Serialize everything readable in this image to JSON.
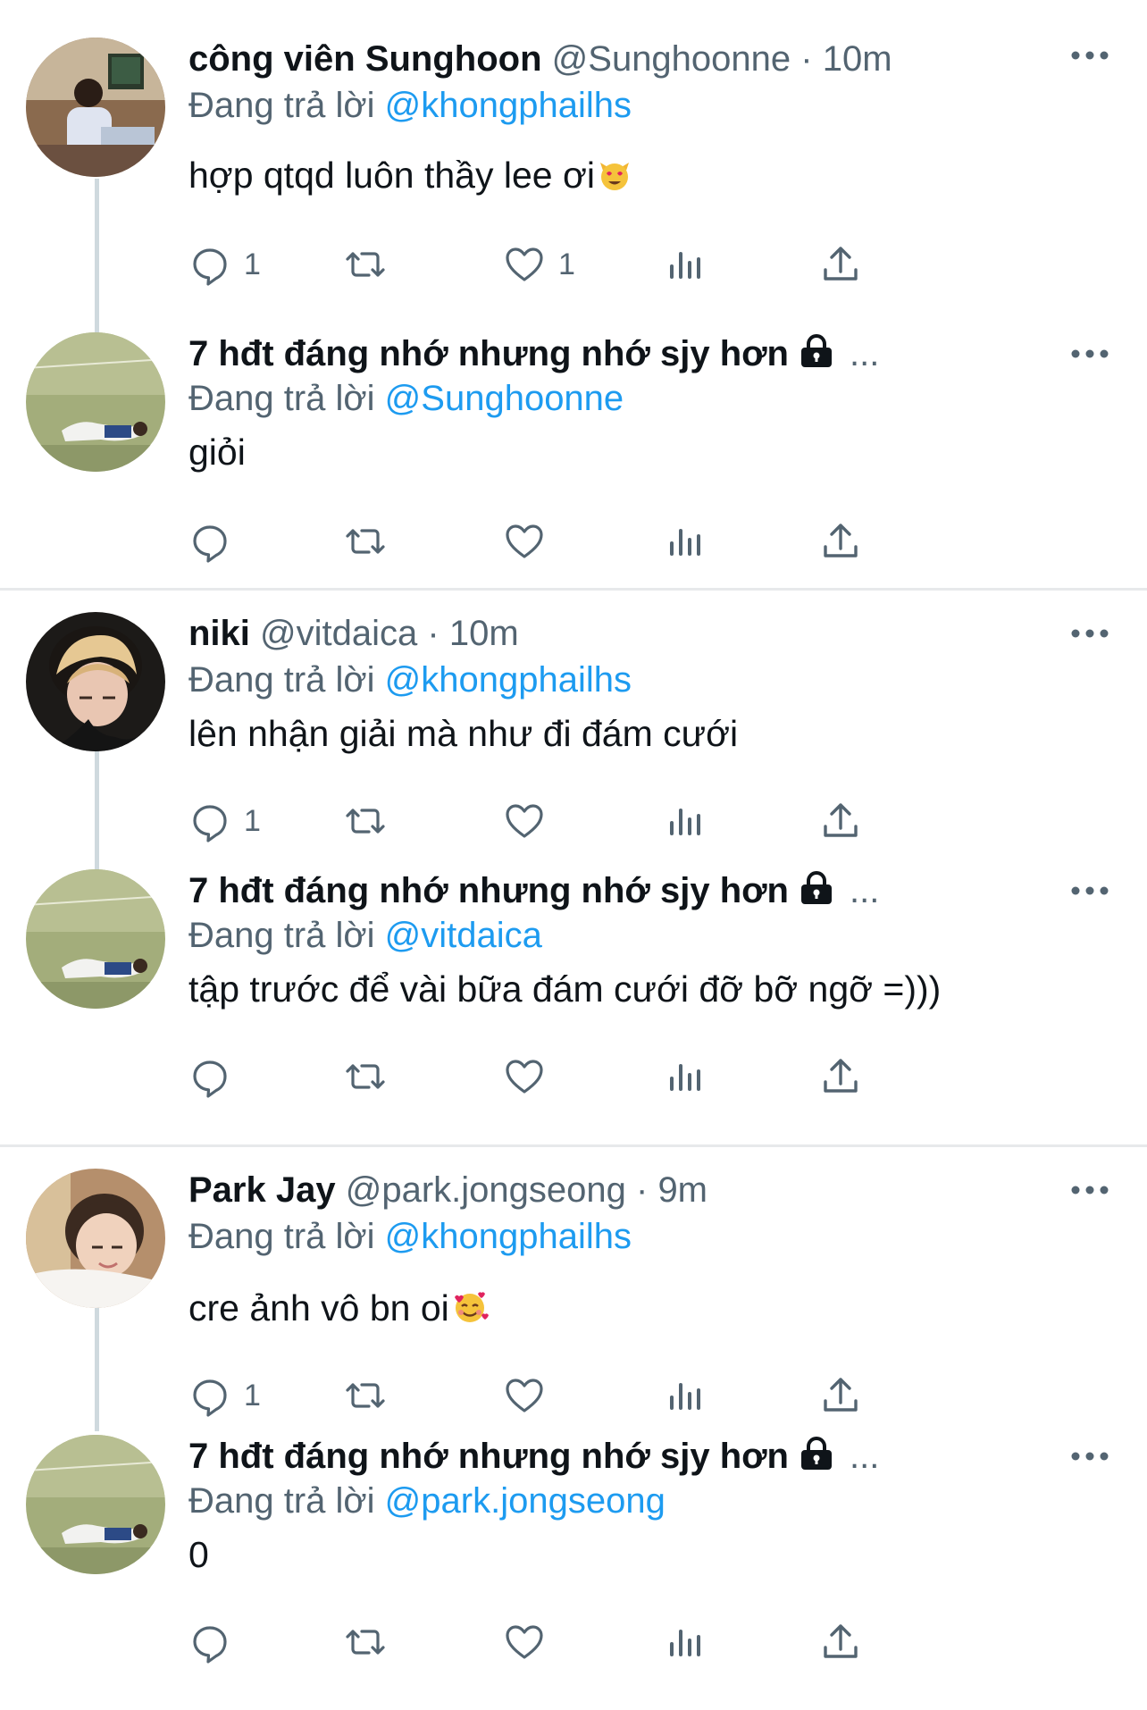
{
  "threads": [
    {
      "parent": {
        "name": "công viên Sunghoon",
        "handle": "@Sunghoonne",
        "dot": "·",
        "time": "10m",
        "replying_prefix": "Đang trả lời",
        "replying_to": "@khongphailhs",
        "text": "hợp qtqd luôn thầy lee ơi",
        "reply_count": "1",
        "retweet_count": "",
        "like_count": "1"
      },
      "reply": {
        "name": "7 hđt đáng nhớ nhưng nhớ sjy hơn",
        "ellipsis": "...",
        "replying_prefix": "Đang trả lời",
        "replying_to": "@Sunghoonne",
        "text": "giỏi",
        "reply_count": "",
        "retweet_count": "",
        "like_count": ""
      }
    },
    {
      "parent": {
        "name": "niki",
        "handle": "@vitdaica",
        "dot": "·",
        "time": "10m",
        "replying_prefix": "Đang trả lời",
        "replying_to": "@khongphailhs",
        "text": "lên nhận giải mà như đi đám cưới",
        "reply_count": "1",
        "retweet_count": "",
        "like_count": ""
      },
      "reply": {
        "name": "7 hđt đáng nhớ nhưng nhớ sjy hơn",
        "ellipsis": "...",
        "replying_prefix": "Đang trả lời",
        "replying_to": "@vitdaica",
        "text": "tập trước để vài bữa đám cưới đỡ bỡ ngỡ =)))",
        "reply_count": "",
        "retweet_count": "",
        "like_count": ""
      }
    },
    {
      "parent": {
        "name": "Park Jay",
        "handle": "@park.jongseong",
        "dot": "·",
        "time": "9m",
        "replying_prefix": "Đang trả lời",
        "replying_to": "@khongphailhs",
        "text": "cre ảnh vô bn oi",
        "reply_count": "1",
        "retweet_count": "",
        "like_count": ""
      },
      "reply": {
        "name": "7 hđt đáng nhớ nhưng nhớ sjy hơn",
        "ellipsis": "...",
        "replying_prefix": "Đang trả lời",
        "replying_to": "@park.jongseong",
        "text": "0",
        "reply_count": "",
        "retweet_count": "",
        "like_count": ""
      }
    }
  ],
  "icons": {
    "more": "more-horizontal-icon",
    "reply": "reply-icon",
    "retweet": "retweet-icon",
    "like": "like-icon",
    "views": "views-icon",
    "share": "share-icon",
    "lock": "lock-icon"
  },
  "colors": {
    "link": "#1d9bf0",
    "secondary": "#536471",
    "text": "#0f1419",
    "thread_line": "#cfd9de"
  }
}
